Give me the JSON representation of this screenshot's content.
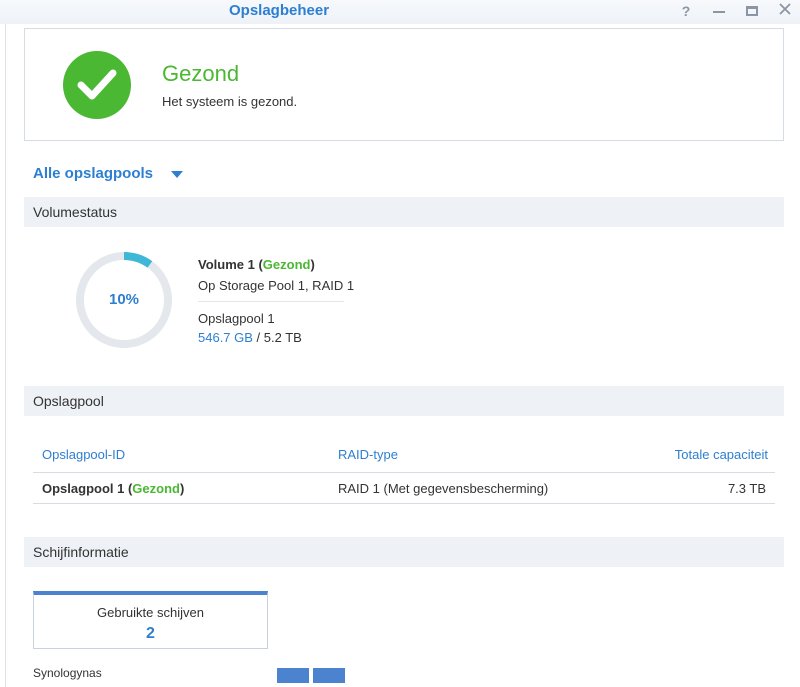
{
  "window": {
    "title": "Opslagbeheer",
    "controls": {
      "help": "?"
    }
  },
  "health": {
    "status": "Gezond",
    "message": "Het systeem is gezond.",
    "color": "#4ab832"
  },
  "pool_selector": {
    "label": "Alle opslagpools"
  },
  "volume_section": {
    "title": "Volumestatus",
    "usage_percent_label": "10%",
    "usage_fraction": 0.1,
    "volume_name": "Volume 1",
    "volume_status": "Gezond",
    "location": "Op Storage Pool 1, RAID 1",
    "pool_name": "Opslagpool 1",
    "used": "546.7 GB",
    "separator": " / ",
    "total": "5.2 TB"
  },
  "pool_section": {
    "title": "Opslagpool",
    "columns": [
      "Opslagpool-ID",
      "RAID-type",
      "Totale capaciteit"
    ],
    "rows": [
      {
        "name": "Opslagpool 1",
        "status": "Gezond",
        "raid": "RAID 1 (Met gegevensbescherming)",
        "capacity": "7.3 TB"
      }
    ]
  },
  "disk_section": {
    "title": "Schijfinformatie",
    "used_disks_label": "Gebruikte schijven",
    "used_disks_count": "2",
    "host_name": "Synologynas",
    "disk_slots": 2
  },
  "colors": {
    "accent": "#2d7fd1",
    "healthy": "#4ab832",
    "usage_arc": "#3fb7d6",
    "track": "#e4e7eb"
  }
}
